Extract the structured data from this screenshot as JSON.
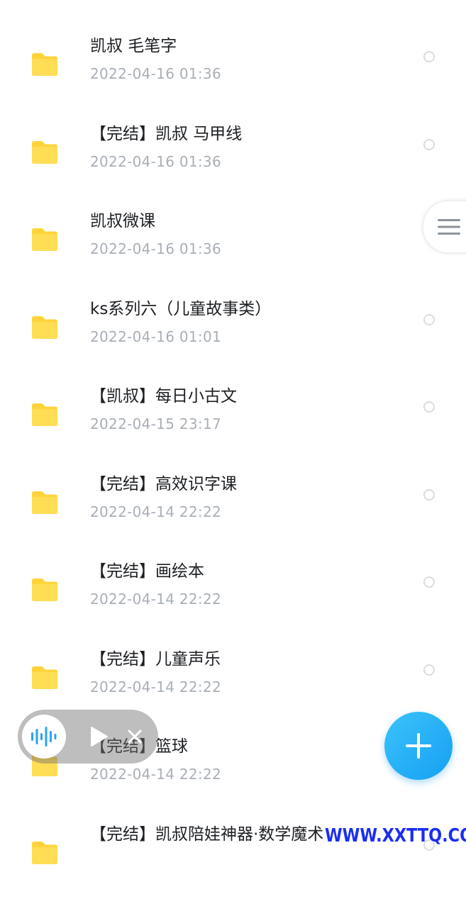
{
  "files": [
    {
      "name": "凯叔 毛笔字",
      "date": "2022-04-16  01:36"
    },
    {
      "name": "【完结】凯叔 马甲线",
      "date": "2022-04-16  01:36"
    },
    {
      "name": "凯叔微课",
      "date": "2022-04-16  01:36"
    },
    {
      "name": "ks系列六（儿童故事类）",
      "date": "2022-04-16  01:01"
    },
    {
      "name": "【凯叔】每日小古文",
      "date": "2022-04-15  23:17"
    },
    {
      "name": "【完结】高效识字课",
      "date": "2022-04-14  22:22"
    },
    {
      "name": "【完结】画绘本",
      "date": "2022-04-14  22:22"
    },
    {
      "name": "【完结】儿童声乐",
      "date": "2022-04-14  22:22"
    },
    {
      "name": "【完结】篮球",
      "date": "2022-04-14  22:22"
    },
    {
      "name": "【完结】凯叔陪娃神器·数学魔术",
      "date": ""
    }
  ],
  "icons": {
    "folder": "folder-icon",
    "select": "select-circle-icon",
    "menu": "menu-icon",
    "wave": "audio-wave-icon",
    "play": "play-icon",
    "close": "close-icon",
    "add": "plus-icon"
  },
  "colors": {
    "folder": "#ffd43b",
    "accent": "#1da7f4",
    "text": "#1c1f23",
    "subtext": "#a9afb8"
  },
  "watermark": "WWW.XXTTQ.COM"
}
